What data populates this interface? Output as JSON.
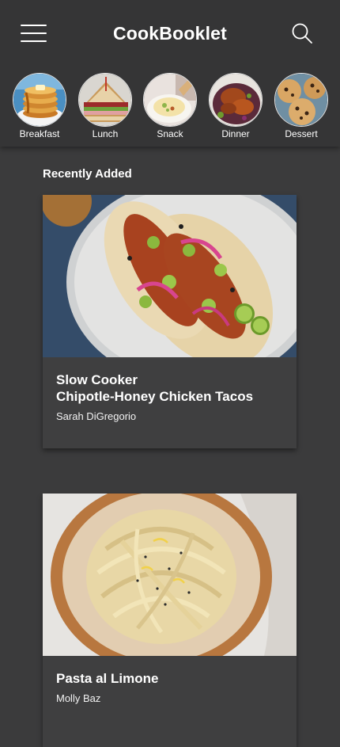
{
  "app": {
    "title": "CookBooklet"
  },
  "header": {
    "menu_icon": "hamburger-menu-icon",
    "search_icon": "search-icon"
  },
  "categories": [
    {
      "label": "Breakfast",
      "image": "pancakes-image"
    },
    {
      "label": "Lunch",
      "image": "sandwich-image"
    },
    {
      "label": "Snack",
      "image": "hummus-image"
    },
    {
      "label": "Dinner",
      "image": "roast-chicken-image"
    },
    {
      "label": "Dessert",
      "image": "cookies-image"
    }
  ],
  "recently_added": {
    "heading": "Recently Added",
    "recipes": [
      {
        "title": "Slow Cooker\nChipotle-Honey Chicken Tacos",
        "author": "Sarah DiGregorio",
        "image": "chicken-tacos-image"
      },
      {
        "title": "Pasta al Limone",
        "author": "Molly Baz",
        "image": "pasta-limone-image"
      }
    ]
  },
  "colors": {
    "background": "#3b3b3c",
    "header": "#353536",
    "card": "#3f3f40",
    "text": "#ffffff"
  }
}
